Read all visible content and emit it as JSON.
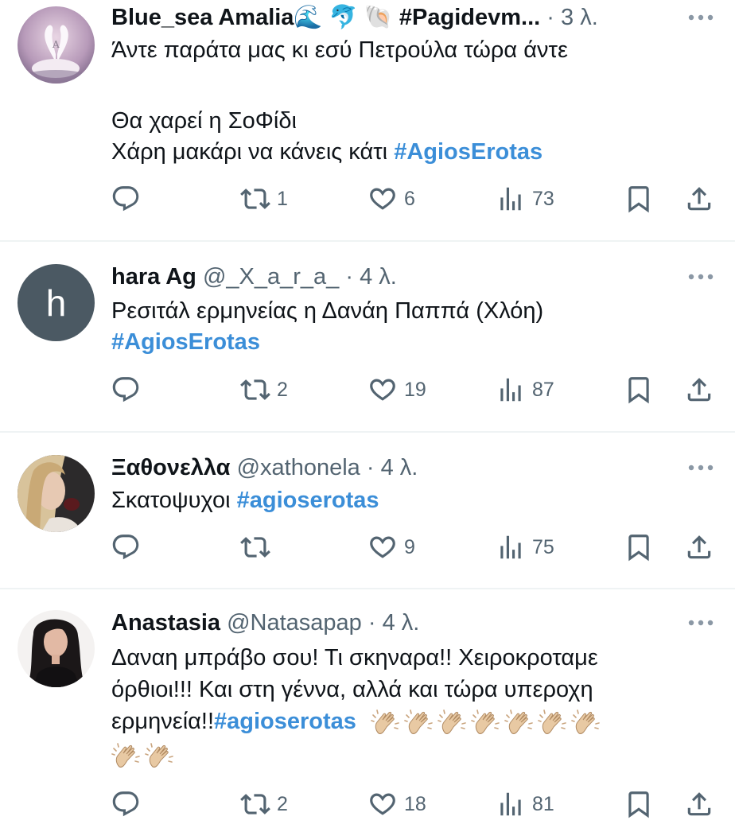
{
  "tweets": [
    {
      "name": "Blue_sea Amalia🌊 🐬 🐚 #Pagidevm...",
      "handle": "",
      "dot": "·",
      "time": "3 λ.",
      "lines": [
        "Άντε παράτα μας κι εσύ Πετρούλα τώρα άντε",
        "",
        "Θα χαρεί η ΣοΦίδι"
      ],
      "last_line_text": "Χάρη μακάρι να κάνεις κάτι ",
      "hashtag": "#AgiosErotas",
      "replies": "",
      "retweets": "1",
      "likes": "6",
      "views": "73"
    },
    {
      "name": "hara Ag",
      "handle": "@_X_a_r_a_",
      "dot": "·",
      "time": "4 λ.",
      "avatar_letter": "h",
      "line1": "Ρεσιτάλ ερμηνείας η Δανάη Παππά (Χλόη)",
      "hashtag": "#AgiosErotas",
      "replies": "",
      "retweets": "2",
      "likes": "19",
      "views": "87"
    },
    {
      "name": "Ξαθονελλα",
      "handle": "@xathonela",
      "dot": "·",
      "time": "4 λ.",
      "text": "Σκατοψυχοι ",
      "hashtag": "#agioserotas",
      "replies": "",
      "retweets": "",
      "likes": "9",
      "views": "75"
    },
    {
      "name": "Anastasia",
      "handle": "@Natasapap",
      "dot": "·",
      "time": "4 λ.",
      "line1": "Δαναη μπράβο σου! Τι σκηναρα!! Χειροκροταμε",
      "line2": "όρθιοι!!! Και στη γέννα, αλλά και τώρα υπεροχη",
      "line3": "ερμηνεία!! ",
      "hashtag": "#agioserotas",
      "replies": "",
      "retweets": "2",
      "likes": "18",
      "views": "81"
    }
  ],
  "colors": {
    "text": "#0f1419",
    "secondary": "#536471",
    "hashtag": "#3b8ed8",
    "divider": "#eff3f4",
    "avatar_h": "#4b5963"
  },
  "icons": [
    "reply-icon",
    "retweet-icon",
    "like-icon",
    "views-icon",
    "bookmark-icon",
    "share-icon",
    "more-icon",
    "clap-emoji"
  ]
}
